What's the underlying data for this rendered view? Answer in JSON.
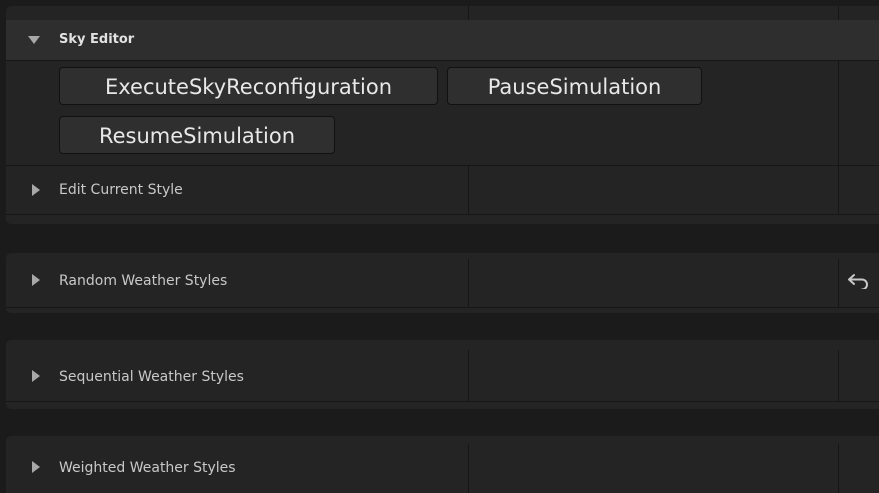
{
  "sky_editor": {
    "title": "Sky Editor",
    "expanded": true,
    "buttons": {
      "execute": "ExecuteSkyReconfiguration",
      "pause": "PauseSimulation",
      "resume": "ResumeSimulation"
    },
    "edit_current_style": "Edit Current Style"
  },
  "categories": {
    "random": "Random Weather Styles",
    "sequential": "Sequential Weather Styles",
    "weighted": "Weighted Weather Styles"
  },
  "icons": {
    "expanded_arrow": "triangle-down-icon",
    "collapsed_arrow": "triangle-right-icon",
    "reset": "reset-to-default-icon"
  }
}
